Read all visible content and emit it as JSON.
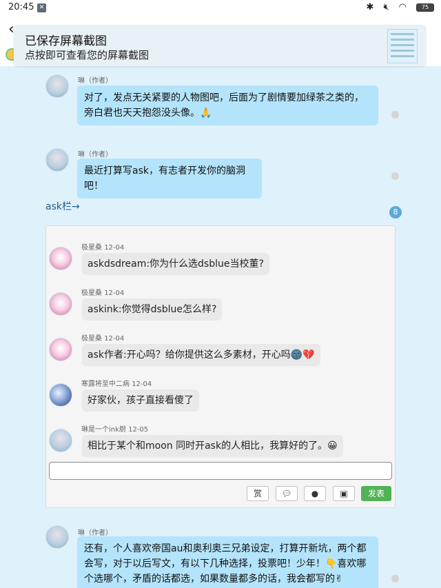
{
  "status": {
    "time": "20:45",
    "battery": "75"
  },
  "toast": {
    "title": "已保存屏幕截图",
    "subtitle": "点按即可查看您的屏幕截图"
  },
  "messages": [
    {
      "author": "琳（作者）",
      "text": "对了，发点无关紧要的人物图吧，后面为了剧情要加绿茶之类的，旁白君也天天抱怨没头像。🙏"
    },
    {
      "author": "琳（作者）",
      "text": "最近打算写ask，有志者开发你的脑洞吧！"
    }
  ],
  "ask_link": "ask栏→",
  "comment_count": "8",
  "asks": [
    {
      "author": "极星桑",
      "date": "12-04",
      "text": "askdsdream:你为什么选dsblue当校董?"
    },
    {
      "author": "极星桑",
      "date": "12-04",
      "text": "askink:你觉得dsblue怎么样?"
    },
    {
      "author": "极星桑",
      "date": "12-04",
      "text": "ask作者:开心吗？给你提供这么多素材，开心吗🌚💔"
    },
    {
      "author": "寒露将至中二病",
      "date": "12-04",
      "text": "好家伙，孩子直接看傻了"
    },
    {
      "author": "琳是一个ink厨",
      "date": "12-05",
      "text": "相比于某个和moon 同时开ask的人相比，我算好的了。😀"
    }
  ],
  "toolbar": {
    "reward": "赏",
    "send": "发表"
  },
  "last_message": {
    "author": "琳（作者）",
    "text": "还有，个人喜欢帝国au和奥利奥三兄弟设定，打算开新坑，两个都会写，对于以后写文，有以下几种选择，投票吧！少年！👇喜欢哪个选哪个，矛盾的话都选，如果数量都多的话，我会都写的✌"
  },
  "colors": {
    "background": "#dff1fb",
    "bubble": "#b4e4fb",
    "send": "#52b256",
    "badge": "#5ba9d8"
  }
}
